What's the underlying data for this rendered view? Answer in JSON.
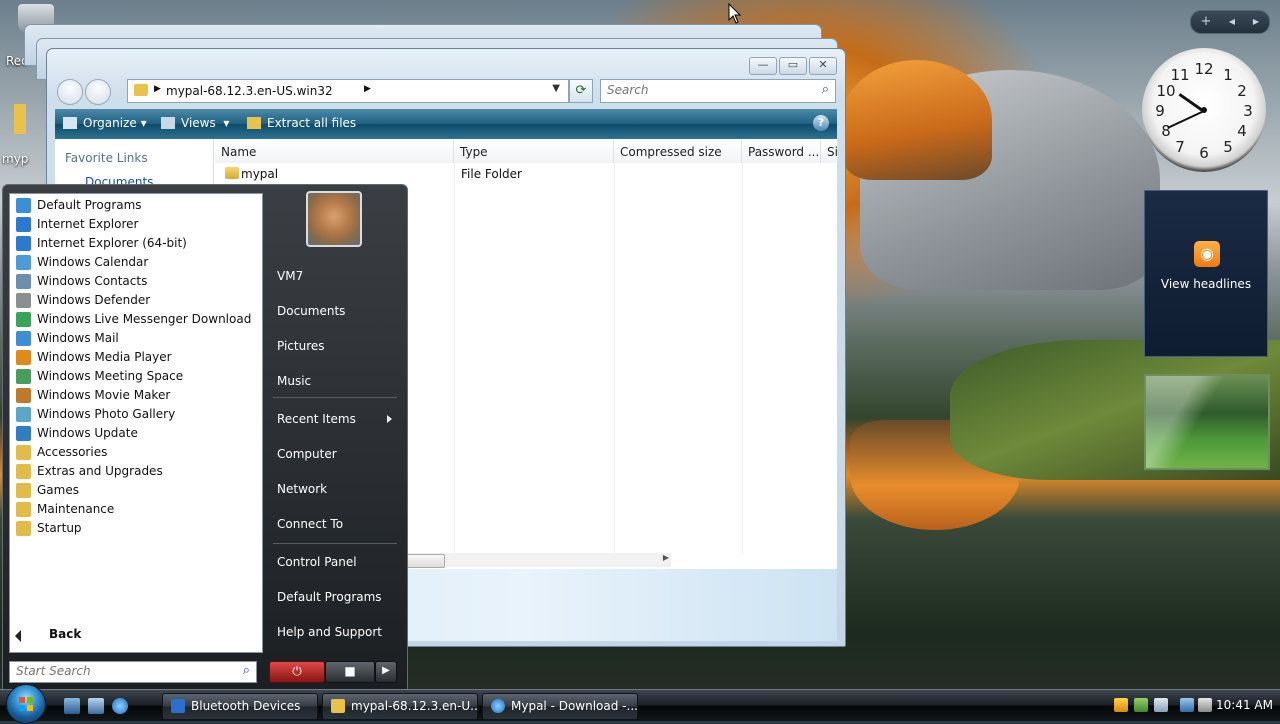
{
  "desktop": {
    "recycle_label": "Rec",
    "mypal_label": "myp"
  },
  "gadgets": {
    "toolbar_add": "+",
    "toolbar_prev": "◀",
    "toolbar_next": "▶",
    "clock_numbers": [
      "12",
      "1",
      "2",
      "3",
      "4",
      "5",
      "6",
      "7",
      "8",
      "9",
      "10",
      "11"
    ],
    "feed_label": "View headlines",
    "feed_icon": "rss-icon"
  },
  "explorer": {
    "address": "mypal-68.12.3.en-US.win32",
    "search_placeholder": "Search",
    "commands": {
      "organize": "Organize",
      "views": "Views",
      "extract": "Extract all files"
    },
    "nav": {
      "favorite_links": "Favorite Links",
      "documents": "Documents"
    },
    "columns": [
      "Name",
      "Type",
      "Compressed size",
      "Password ...",
      "Si"
    ],
    "rows": [
      {
        "name": "mypal",
        "type": "File Folder"
      }
    ]
  },
  "start_menu": {
    "programs": [
      {
        "label": "Default Programs",
        "color": "#3a8fd8"
      },
      {
        "label": "Internet Explorer",
        "color": "#2b7ad0"
      },
      {
        "label": "Internet Explorer (64-bit)",
        "color": "#2b7ad0"
      },
      {
        "label": "Windows Calendar",
        "color": "#4d9ad6"
      },
      {
        "label": "Windows Contacts",
        "color": "#6c8fae"
      },
      {
        "label": "Windows Defender",
        "color": "#8a8f94"
      },
      {
        "label": "Windows Live Messenger Download",
        "color": "#3aa35a"
      },
      {
        "label": "Windows Mail",
        "color": "#3b8fd2"
      },
      {
        "label": "Windows Media Player",
        "color": "#e08a1e"
      },
      {
        "label": "Windows Meeting Space",
        "color": "#4a9d5a"
      },
      {
        "label": "Windows Movie Maker",
        "color": "#c0792a"
      },
      {
        "label": "Windows Photo Gallery",
        "color": "#5aa5c8"
      },
      {
        "label": "Windows Update",
        "color": "#2f7ec2"
      },
      {
        "label": "Accessories",
        "color": "#e2bc4a"
      },
      {
        "label": "Extras and Upgrades",
        "color": "#e2bc4a"
      },
      {
        "label": "Games",
        "color": "#e2bc4a"
      },
      {
        "label": "Maintenance",
        "color": "#e2bc4a"
      },
      {
        "label": "Startup",
        "color": "#e2bc4a"
      }
    ],
    "back_label": "Back",
    "search_placeholder": "Start Search",
    "right": {
      "user": "VM7",
      "documents": "Documents",
      "pictures": "Pictures",
      "music": "Music",
      "recent": "Recent Items",
      "computer": "Computer",
      "network": "Network",
      "connect": "Connect To",
      "control_panel": "Control Panel",
      "default_programs": "Default Programs",
      "help": "Help and Support"
    }
  },
  "taskbar": {
    "buttons": [
      {
        "label": "Bluetooth Devices"
      },
      {
        "label": "mypal-68.12.3.en-U..."
      },
      {
        "label": "Mypal - Download -..."
      }
    ],
    "clock": "10:41 AM"
  }
}
